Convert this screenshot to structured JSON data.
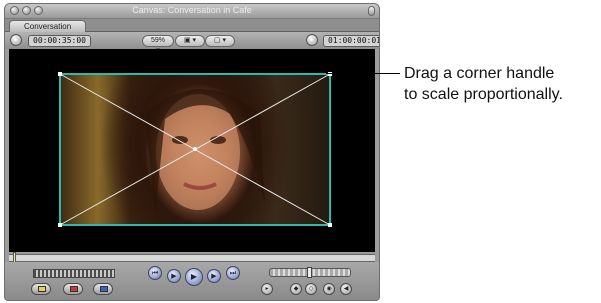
{
  "window": {
    "title": "Canvas: Conversation in Cafe",
    "tab_label": "Conversation"
  },
  "toolbar": {
    "timecode_duration": "00:00:35:00",
    "zoom_label": "59%",
    "view_label": "",
    "overlay_label": "",
    "timecode_current": "01:00:00:01"
  },
  "viewer": {
    "image_description": "",
    "bounding_box_color": "#2fb8b0",
    "handle_color": "#ffffff"
  },
  "transport": {
    "buttons": [
      "previous-edit",
      "play-in-to-out",
      "play",
      "play-around",
      "next-edit"
    ]
  },
  "callout": {
    "line1": "Drag a corner handle",
    "line2": "to scale proportionally."
  },
  "colors": {
    "window_gray": "#9c9c9c",
    "viewer_bg": "#000000",
    "transport_blue": "#8b98c4"
  }
}
